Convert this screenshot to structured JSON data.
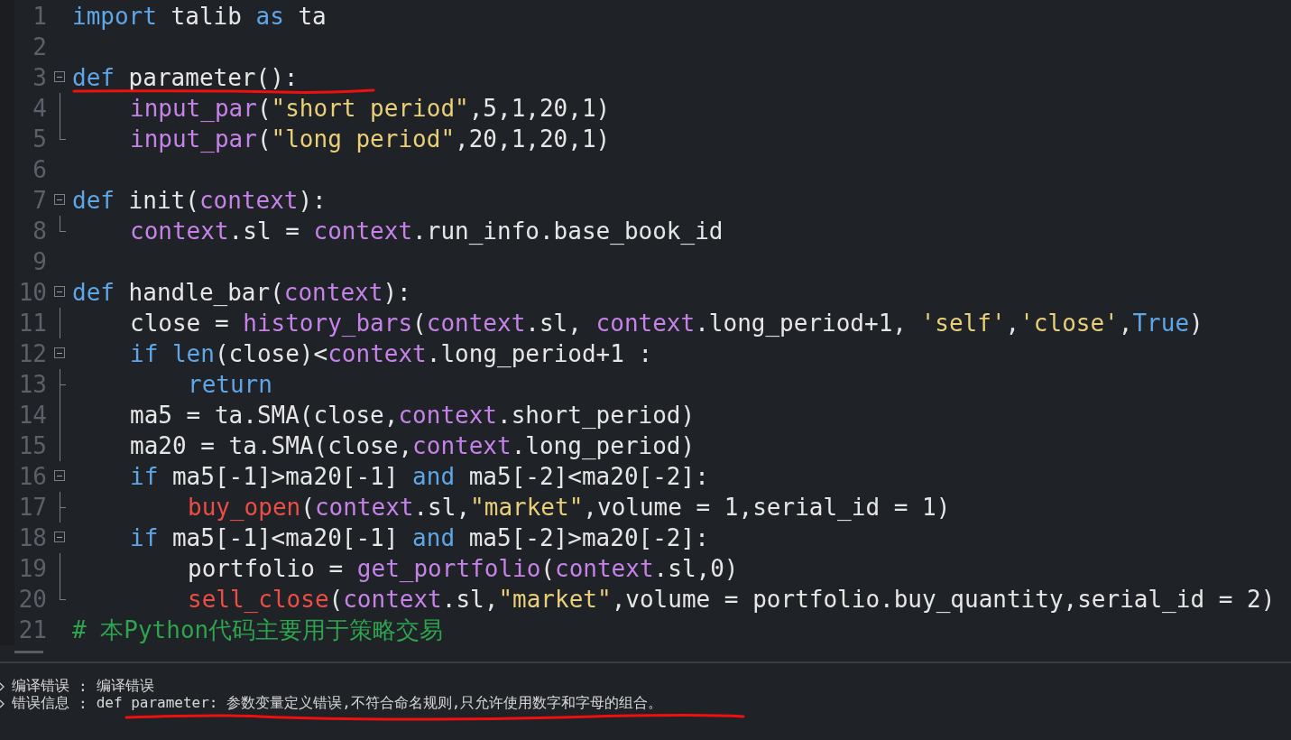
{
  "editor": {
    "lines": [
      {
        "number": "1",
        "kind": "top",
        "tokens": [
          {
            "t": "import",
            "kind": "kw"
          },
          {
            "t": " talib ",
            "kind": "plain"
          },
          {
            "t": "as",
            "kind": "kw"
          },
          {
            "t": " ta",
            "kind": "plain"
          }
        ]
      },
      {
        "number": "2"
      },
      {
        "number": "3",
        "kind": "top",
        "fold": {
          "kind": "open"
        },
        "tokens": [
          {
            "t": "def",
            "kind": "kw"
          },
          {
            "t": " parameter():",
            "kind": "plain"
          }
        ]
      },
      {
        "number": "4",
        "kind": "block",
        "fold": {
          "kind": "line"
        },
        "tokens": [
          {
            "t": "input_par",
            "kind": "fn"
          },
          {
            "t": "(",
            "kind": "plain"
          },
          {
            "t": "\"short period\"",
            "kind": "str"
          },
          {
            "t": ",5,1,20,1)",
            "kind": "plain"
          }
        ]
      },
      {
        "number": "5",
        "kind": "block",
        "fold": {
          "kind": "end"
        },
        "tokens": [
          {
            "t": "input_par",
            "kind": "fn"
          },
          {
            "t": "(",
            "kind": "plain"
          },
          {
            "t": "\"long period\"",
            "kind": "str"
          },
          {
            "t": ",20,1,20,1)",
            "kind": "plain"
          }
        ]
      },
      {
        "number": "6"
      },
      {
        "number": "7",
        "kind": "top",
        "fold": {
          "kind": "open"
        },
        "tokens": [
          {
            "t": "def",
            "kind": "kw"
          },
          {
            "t": " init(",
            "kind": "plain"
          },
          {
            "t": "context",
            "kind": "fn"
          },
          {
            "t": "):",
            "kind": "plain"
          }
        ]
      },
      {
        "number": "8",
        "kind": "block",
        "fold": {
          "kind": "end"
        },
        "tokens": [
          {
            "t": "context",
            "kind": "fn"
          },
          {
            "t": ".sl = ",
            "kind": "plain"
          },
          {
            "t": "context",
            "kind": "fn"
          },
          {
            "t": ".run_info.base_book_id",
            "kind": "plain"
          }
        ]
      },
      {
        "number": "9"
      },
      {
        "number": "10",
        "kind": "top",
        "fold": {
          "kind": "open"
        },
        "tokens": [
          {
            "t": "def",
            "kind": "kw"
          },
          {
            "t": " handle_bar(",
            "kind": "plain"
          },
          {
            "t": "context",
            "kind": "fn"
          },
          {
            "t": "):",
            "kind": "plain"
          }
        ]
      },
      {
        "number": "11",
        "kind": "block",
        "fold": {
          "kind": "line"
        },
        "tokens": [
          {
            "t": "close = ",
            "kind": "plain"
          },
          {
            "t": "history_bars",
            "kind": "fn"
          },
          {
            "t": "(",
            "kind": "plain"
          },
          {
            "t": "context",
            "kind": "fn"
          },
          {
            "t": ".sl, ",
            "kind": "plain"
          },
          {
            "t": "context",
            "kind": "fn"
          },
          {
            "t": ".long_period+1, ",
            "kind": "plain"
          },
          {
            "t": "'self'",
            "kind": "str"
          },
          {
            "t": ",",
            "kind": "plain"
          },
          {
            "t": "'close'",
            "kind": "str"
          },
          {
            "t": ",",
            "kind": "plain"
          },
          {
            "t": "True",
            "kind": "kw"
          },
          {
            "t": ")",
            "kind": "plain"
          }
        ]
      },
      {
        "number": "12",
        "kind": "block",
        "fold": {
          "kind": "open"
        },
        "tokens": [
          {
            "t": "if",
            "kind": "kw"
          },
          {
            "t": " len",
            "kind": "kw"
          },
          {
            "t": "(close)<",
            "kind": "plain"
          },
          {
            "t": "context",
            "kind": "fn"
          },
          {
            "t": ".long_period+1 :",
            "kind": "plain"
          }
        ]
      },
      {
        "number": "13",
        "kind": "nested",
        "fold": {
          "kind": "branch"
        },
        "tokens": [
          {
            "t": "return",
            "kind": "kw"
          }
        ]
      },
      {
        "number": "14",
        "kind": "block",
        "fold": {
          "kind": "line"
        },
        "tokens": [
          {
            "t": "ma5 = ta.SMA(close,",
            "kind": "plain"
          },
          {
            "t": "context",
            "kind": "fn"
          },
          {
            "t": ".short_period)",
            "kind": "plain"
          }
        ]
      },
      {
        "number": "15",
        "kind": "block",
        "fold": {
          "kind": "line"
        },
        "tokens": [
          {
            "t": "ma20 = ta.SMA(close,",
            "kind": "plain"
          },
          {
            "t": "context",
            "kind": "fn"
          },
          {
            "t": ".long_period)",
            "kind": "plain"
          }
        ]
      },
      {
        "number": "16",
        "kind": "block",
        "fold": {
          "kind": "open"
        },
        "tokens": [
          {
            "t": "if",
            "kind": "kw"
          },
          {
            "t": " ma5[-1]>ma20[-1] ",
            "kind": "plain"
          },
          {
            "t": "and",
            "kind": "kw"
          },
          {
            "t": " ma5[-2]<ma20[-2]:",
            "kind": "plain"
          }
        ]
      },
      {
        "number": "17",
        "kind": "nested",
        "fold": {
          "kind": "branch"
        },
        "tokens": [
          {
            "t": "buy_open",
            "kind": "order"
          },
          {
            "t": "(",
            "kind": "plain"
          },
          {
            "t": "context",
            "kind": "fn"
          },
          {
            "t": ".sl,",
            "kind": "plain"
          },
          {
            "t": "\"market\"",
            "kind": "str"
          },
          {
            "t": ",volume = 1,serial_id = 1)",
            "kind": "plain"
          }
        ]
      },
      {
        "number": "18",
        "kind": "block",
        "fold": {
          "kind": "open"
        },
        "tokens": [
          {
            "t": "if",
            "kind": "kw"
          },
          {
            "t": " ma5[-1]<ma20[-1] ",
            "kind": "plain"
          },
          {
            "t": "and",
            "kind": "kw"
          },
          {
            "t": " ma5[-2]>ma20[-2]:",
            "kind": "plain"
          }
        ]
      },
      {
        "number": "19",
        "kind": "nested",
        "fold": {
          "kind": "line"
        },
        "tokens": [
          {
            "t": "portfolio = ",
            "kind": "plain"
          },
          {
            "t": "get_portfolio",
            "kind": "fn"
          },
          {
            "t": "(",
            "kind": "plain"
          },
          {
            "t": "context",
            "kind": "fn"
          },
          {
            "t": ".sl,0)",
            "kind": "plain"
          }
        ]
      },
      {
        "number": "20",
        "kind": "nested",
        "fold": {
          "kind": "end"
        },
        "tokens": [
          {
            "t": "sell_close",
            "kind": "order"
          },
          {
            "t": "(",
            "kind": "plain"
          },
          {
            "t": "context",
            "kind": "fn"
          },
          {
            "t": ".sl,",
            "kind": "plain"
          },
          {
            "t": "\"market\"",
            "kind": "str"
          },
          {
            "t": ",volume = portfolio.buy_quantity,serial_id = 2)",
            "kind": "plain"
          }
        ]
      },
      {
        "number": "21",
        "kind": "top",
        "tokens": [
          {
            "t": "# 本Python代码主要用于策略交易",
            "kind": "cmt"
          }
        ]
      }
    ]
  },
  "output": {
    "messages": [
      {
        "label": "编译错误",
        "separator": ":",
        "text": "编译错误"
      },
      {
        "label": "错误信息",
        "separator": ":",
        "text": "def parameter: 参数变量定义错误,不符合命名规则,只允许使用数字和字母的组合。"
      }
    ]
  }
}
